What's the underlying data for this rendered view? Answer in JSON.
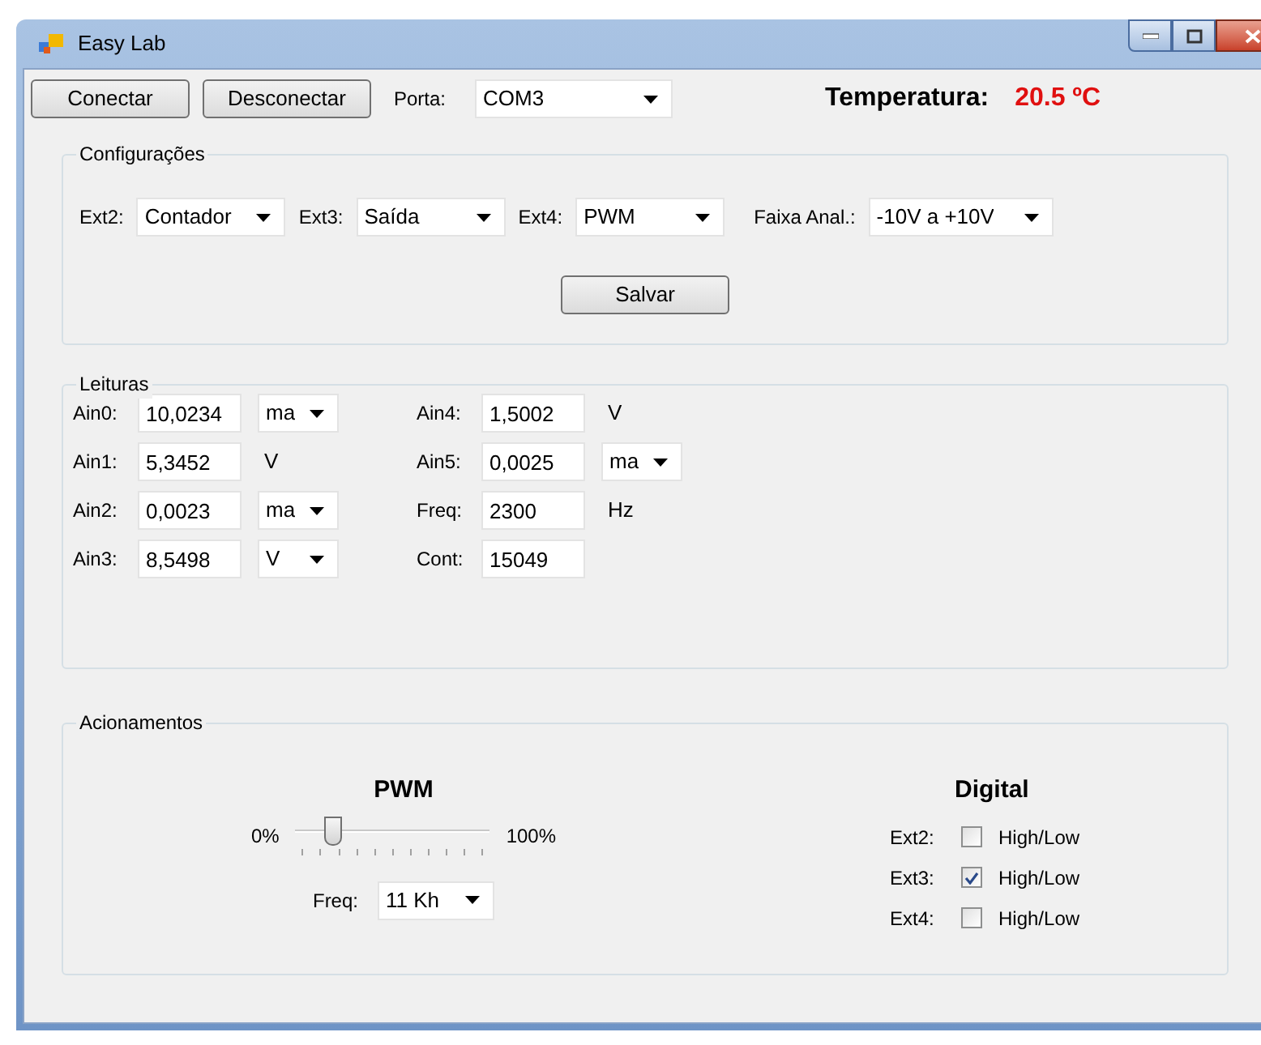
{
  "window": {
    "title": "Easy Lab"
  },
  "toolbar": {
    "buttons": [
      "Conectar",
      "Desconectar"
    ],
    "port_label": "Porta:",
    "port_value": "COM3",
    "temperature_label": "Temperatura:",
    "temperature_value": "20.5 ºC"
  },
  "configuracoes": {
    "title": "Configurações",
    "fields": [
      {
        "label": "Ext2:",
        "value": "Contador"
      },
      {
        "label": "Ext3:",
        "value": "Saída"
      },
      {
        "label": "Ext4:",
        "value": "PWM"
      },
      {
        "label": "Faixa Anal.:",
        "value": "-10V a +10V"
      }
    ],
    "save_button": "Salvar"
  },
  "leituras": {
    "title": "Leituras",
    "columns": [
      [
        {
          "label": "Ain0:",
          "value": "10,0234",
          "unit": {
            "kind": "dropdown",
            "text": "ma"
          }
        },
        {
          "label": "Ain1:",
          "value": "5,3452",
          "unit": {
            "kind": "text",
            "text": "V"
          }
        },
        {
          "label": "Ain2:",
          "value": "0,0023",
          "unit": {
            "kind": "dropdown",
            "text": "ma"
          }
        },
        {
          "label": "Ain3:",
          "value": "8,5498",
          "unit": {
            "kind": "dropdown",
            "text": "V"
          }
        }
      ],
      [
        {
          "label": "Ain4:",
          "value": "1,5002",
          "unit": {
            "kind": "text",
            "text": "V"
          }
        },
        {
          "label": "Ain5:",
          "value": "0,0025",
          "unit": {
            "kind": "dropdown",
            "text": "ma"
          }
        },
        {
          "label": "Freq:",
          "value": "2300",
          "unit": {
            "kind": "text",
            "text": "Hz"
          }
        },
        {
          "label": "Cont:",
          "value": "15049"
        }
      ]
    ]
  },
  "acionamentos": {
    "title": "Acionamentos",
    "pwm": {
      "title": "PWM",
      "min_label": "0%",
      "max_label": "100%",
      "level": 0.2,
      "freq_label": "Freq:",
      "freq_value": "11 Kh"
    },
    "digital": {
      "title": "Digital",
      "outputs": [
        {
          "label": "Ext2:",
          "text": "High/Low",
          "checked": false
        },
        {
          "label": "Ext3:",
          "text": "High/Low",
          "checked": true
        },
        {
          "label": "Ext4:",
          "text": "High/Low",
          "checked": false
        }
      ]
    }
  }
}
